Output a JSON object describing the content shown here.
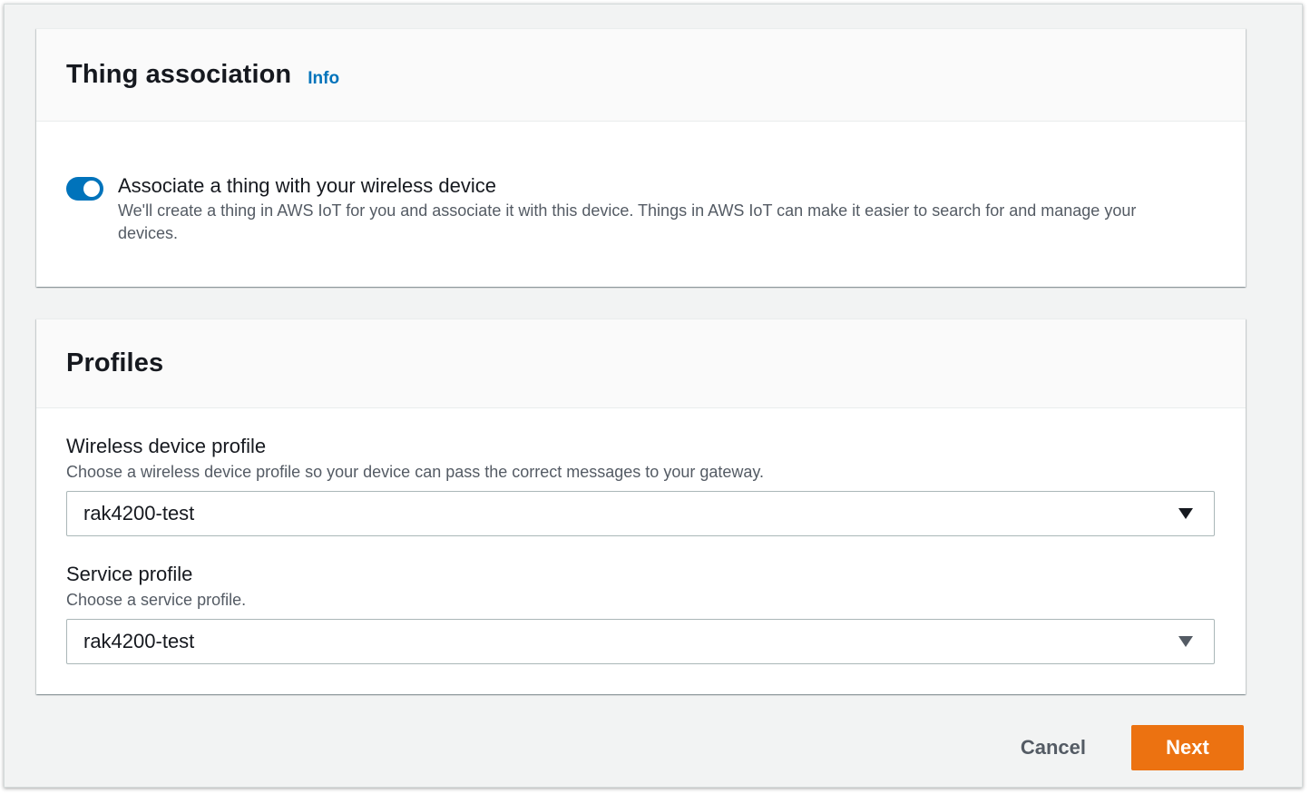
{
  "thing_association": {
    "title": "Thing association",
    "info_label": "Info",
    "toggle": {
      "enabled": true,
      "label": "Associate a thing with your wireless device",
      "description": "We'll create a thing in AWS IoT for you and associate it with this device. Things in AWS IoT can make it easier to search for and manage your devices."
    }
  },
  "profiles": {
    "title": "Profiles",
    "wireless_device_profile": {
      "label": "Wireless device profile",
      "description": "Choose a wireless device profile so your device can pass the correct messages to your gateway.",
      "selected": "rak4200-test"
    },
    "service_profile": {
      "label": "Service profile",
      "description": "Choose a service profile.",
      "selected": "rak4200-test"
    }
  },
  "actions": {
    "cancel_label": "Cancel",
    "next_label": "Next"
  },
  "colors": {
    "accent": "#0073bb",
    "primary_button": "#ec7211",
    "page_background": "#f2f3f3"
  },
  "icons": {
    "select_caret": "caret-down-icon"
  }
}
